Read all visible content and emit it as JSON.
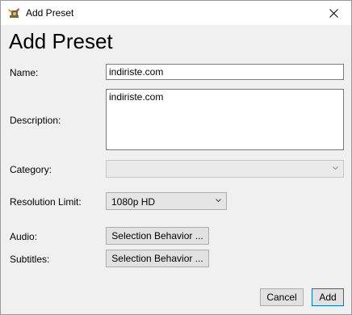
{
  "window": {
    "title": "Add Preset",
    "icon": "handbrake-app-icon"
  },
  "heading": "Add Preset",
  "form": {
    "name_label": "Name:",
    "name_value": "indiriste.com",
    "description_label": "Description:",
    "description_value": "indiriste.com",
    "category_label": "Category:",
    "category_value": "",
    "resolution_label": "Resolution Limit:",
    "resolution_value": "1080p HD",
    "audio_label": "Audio:",
    "audio_button": "Selection Behavior ...",
    "subtitles_label": "Subtitles:",
    "subtitles_button": "Selection Behavior ..."
  },
  "footer": {
    "cancel_label": "Cancel",
    "add_label": "Add"
  },
  "colors": {
    "default_button_border": "#0078d7"
  }
}
